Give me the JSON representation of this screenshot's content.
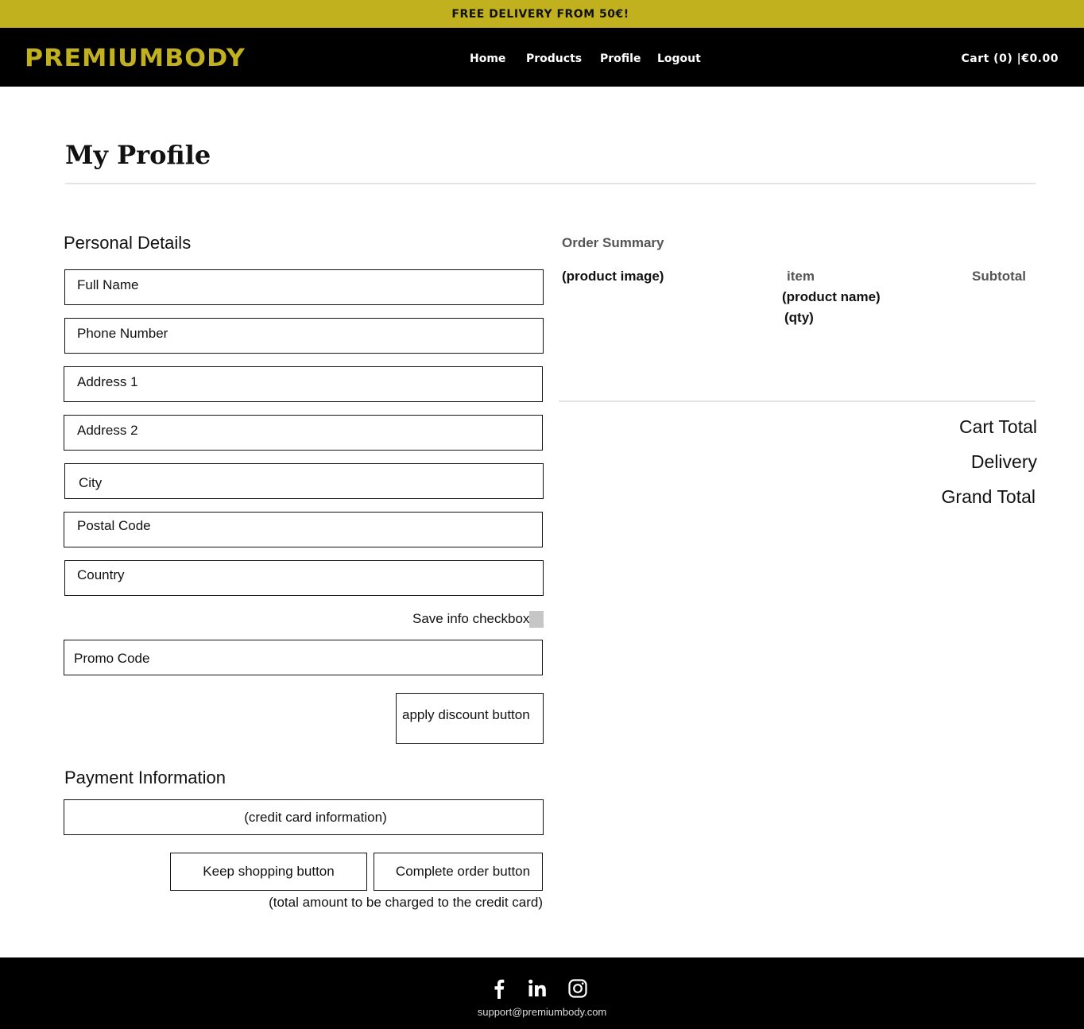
{
  "banner": {
    "text": "FREE DELIVERY FROM 50€!"
  },
  "header": {
    "logo": "PREMIUMBODY",
    "nav": {
      "home": "Home",
      "products": "Products",
      "profile": "Profile",
      "logout": "Logout"
    },
    "cart": "Cart (0) |€0.00"
  },
  "page": {
    "title": "My Profile"
  },
  "personal_details": {
    "heading": "Personal Details",
    "fields": {
      "full_name": "Full Name",
      "phone_number": "Phone Number",
      "address1": "Address 1",
      "address2": "Address 2",
      "city": "City",
      "postal_code": "Postal Code",
      "country": "Country"
    },
    "save_info_label": "Save info checkbox",
    "promo_code": "Promo Code",
    "apply_discount_label": "apply discount button"
  },
  "payment": {
    "heading": "Payment Information",
    "credit_card": "(credit card information)",
    "keep_shopping_label": "Keep shopping button",
    "complete_order_label": "Complete order button",
    "charge_note": "(total amount to be charged to the credit card)"
  },
  "order_summary": {
    "heading": "Order Summary",
    "col_image": "(product image)",
    "col_item": "item",
    "item_name": "(product name)",
    "item_qty": "(qty)",
    "col_subtotal": "Subtotal",
    "cart_total": "Cart Total",
    "delivery": "Delivery",
    "grand_total": "Grand Total"
  },
  "footer": {
    "icons": [
      "facebook-icon",
      "linkedin-icon",
      "instagram-icon"
    ],
    "email": "support@premiumbody.com"
  },
  "colors": {
    "accent": "#c2b11f",
    "nav_bg": "#000000",
    "checkbox": "#c6c6c6"
  }
}
